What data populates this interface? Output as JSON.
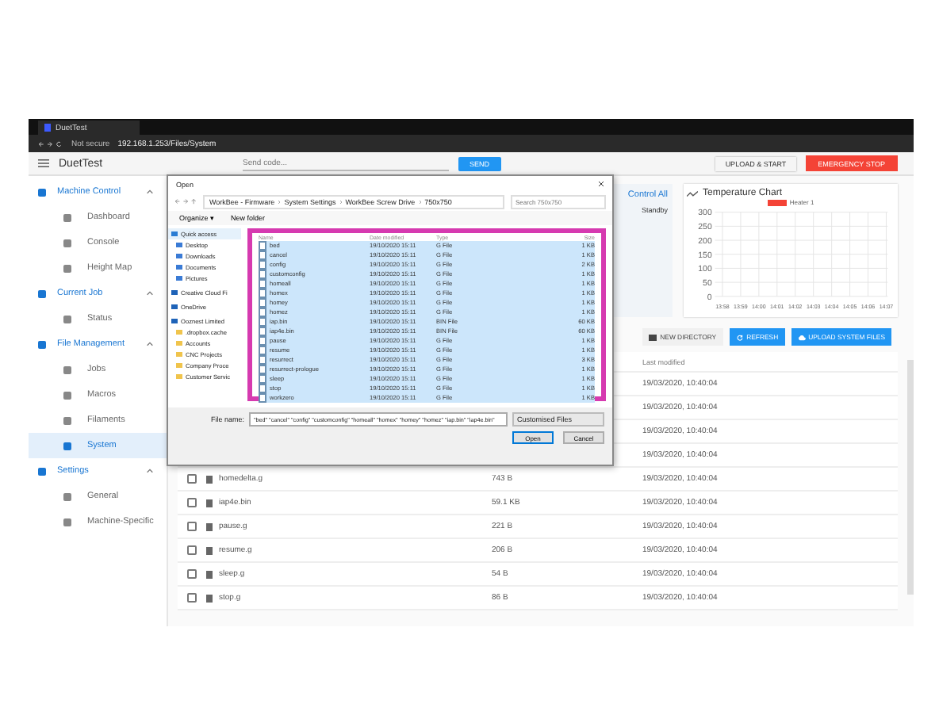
{
  "browser": {
    "tab": "DuetTest",
    "security": "Not secure",
    "address": "192.168.1.253/Files/System"
  },
  "app_bar": {
    "title": "DuetTest",
    "code_placeholder": "Send code...",
    "send": "SEND",
    "upload_start": "UPLOAD & START",
    "emergency": "EMERGENCY STOP"
  },
  "sidebar": [
    {
      "label": "Machine Control",
      "expanded": true,
      "children": [
        {
          "label": "Dashboard",
          "selected": false
        },
        {
          "label": "Console",
          "selected": false
        },
        {
          "label": "Height Map",
          "selected": false
        }
      ]
    },
    {
      "label": "Current Job",
      "expanded": true,
      "children": [
        {
          "label": "Status",
          "selected": false
        }
      ]
    },
    {
      "label": "File Management",
      "expanded": true,
      "children": [
        {
          "label": "Jobs",
          "selected": false
        },
        {
          "label": "Macros",
          "selected": false
        },
        {
          "label": "Filaments",
          "selected": false
        },
        {
          "label": "System",
          "selected": true
        }
      ]
    },
    {
      "label": "Settings",
      "expanded": true,
      "children": [
        {
          "label": "General",
          "selected": false
        },
        {
          "label": "Machine-Specific",
          "selected": false
        }
      ]
    }
  ],
  "tools_panel": {
    "control_all": "Control All",
    "standby": "Standby"
  },
  "temperature_chart": {
    "title": "Temperature Chart",
    "chart_data": {
      "type": "line",
      "grid": true,
      "categories": [
        "13:58",
        "13:59",
        "14:00",
        "14:01",
        "14:02",
        "14:03",
        "14:04",
        "14:05",
        "14:06",
        "14:07"
      ],
      "ylim": [
        0,
        300
      ],
      "yticks": [
        0,
        50,
        100,
        150,
        200,
        250,
        300
      ],
      "series": [
        {
          "name": "Heater 1",
          "color": "#f44336",
          "values": [
            null,
            null,
            null,
            null,
            null,
            null,
            null,
            null,
            null,
            null
          ]
        }
      ]
    }
  },
  "file_actions": {
    "new_directory": "NEW DIRECTORY",
    "refresh": "REFRESH",
    "upload": "UPLOAD SYSTEM FILES"
  },
  "file_table": {
    "last_modified_header": "Last modified",
    "rows": [
      {
        "modified": "19/03/2020, 10:40:04"
      },
      {
        "modified": "19/03/2020, 10:40:04"
      },
      {
        "modified": "19/03/2020, 10:40:04"
      },
      {
        "modified": "19/03/2020, 10:40:04"
      },
      {
        "name": "homedelta.g",
        "size": "743 B",
        "modified": "19/03/2020, 10:40:04",
        "checked": false
      },
      {
        "name": "iap4e.bin",
        "size": "59.1 KB",
        "modified": "19/03/2020, 10:40:04",
        "checked": false
      },
      {
        "name": "pause.g",
        "size": "221 B",
        "modified": "19/03/2020, 10:40:04",
        "checked": false
      },
      {
        "name": "resume.g",
        "size": "206 B",
        "modified": "19/03/2020, 10:40:04",
        "checked": false
      },
      {
        "name": "sleep.g",
        "size": "54 B",
        "modified": "19/03/2020, 10:40:04",
        "checked": false
      },
      {
        "name": "stop.g",
        "size": "86 B",
        "modified": "19/03/2020, 10:40:04",
        "checked": false
      }
    ]
  },
  "open_dialog": {
    "title": "Open",
    "path": [
      "WorkBee - Firmware",
      "System Settings",
      "WorkBee Screw Drive",
      "750x750"
    ],
    "search_placeholder": "Search 750x750",
    "organize": "Organize ▾",
    "new_folder": "New folder",
    "nav": [
      {
        "label": "Quick access",
        "kind": "star"
      },
      {
        "label": "Desktop",
        "kind": "pinned"
      },
      {
        "label": "Downloads",
        "kind": "pinned"
      },
      {
        "label": "Documents",
        "kind": "pinned"
      },
      {
        "label": "Pictures",
        "kind": "pinned"
      },
      {
        "label": "Creative Cloud Fi",
        "kind": "cloud"
      },
      {
        "label": "OneDrive",
        "kind": "cloud"
      },
      {
        "label": "Ooznest Limited",
        "kind": "cloud"
      },
      {
        "label": ".dropbox.cache",
        "kind": "folder"
      },
      {
        "label": "Accounts",
        "kind": "folder"
      },
      {
        "label": "CNC Projects",
        "kind": "folder"
      },
      {
        "label": "Company Proce",
        "kind": "folder"
      },
      {
        "label": "Customer Servic",
        "kind": "folder"
      }
    ],
    "columns": [
      "Name",
      "Date modified",
      "Type",
      "Size"
    ],
    "files": [
      {
        "name": "bed",
        "date": "19/10/2020 15:11",
        "type": "G File",
        "size": "1 KB",
        "selected": true
      },
      {
        "name": "cancel",
        "date": "19/10/2020 15:11",
        "type": "G File",
        "size": "1 KB",
        "selected": true
      },
      {
        "name": "config",
        "date": "19/10/2020 15:11",
        "type": "G File",
        "size": "2 KB",
        "selected": true
      },
      {
        "name": "customconfig",
        "date": "19/10/2020 15:11",
        "type": "G File",
        "size": "1 KB",
        "selected": true
      },
      {
        "name": "homeall",
        "date": "19/10/2020 15:11",
        "type": "G File",
        "size": "1 KB",
        "selected": true
      },
      {
        "name": "homex",
        "date": "19/10/2020 15:11",
        "type": "G File",
        "size": "1 KB",
        "selected": true
      },
      {
        "name": "homey",
        "date": "19/10/2020 15:11",
        "type": "G File",
        "size": "1 KB",
        "selected": true
      },
      {
        "name": "homez",
        "date": "19/10/2020 15:11",
        "type": "G File",
        "size": "1 KB",
        "selected": true
      },
      {
        "name": "iap.bin",
        "date": "19/10/2020 15:11",
        "type": "BIN File",
        "size": "60 KB",
        "selected": true
      },
      {
        "name": "iap4e.bin",
        "date": "19/10/2020 15:11",
        "type": "BIN File",
        "size": "60 KB",
        "selected": true
      },
      {
        "name": "pause",
        "date": "19/10/2020 15:11",
        "type": "G File",
        "size": "1 KB",
        "selected": true
      },
      {
        "name": "resume",
        "date": "19/10/2020 15:11",
        "type": "G File",
        "size": "1 KB",
        "selected": true
      },
      {
        "name": "resurrect",
        "date": "19/10/2020 15:11",
        "type": "G File",
        "size": "3 KB",
        "selected": true
      },
      {
        "name": "resurrect-prologue",
        "date": "19/10/2020 15:11",
        "type": "G File",
        "size": "1 KB",
        "selected": true
      },
      {
        "name": "sleep",
        "date": "19/10/2020 15:11",
        "type": "G File",
        "size": "1 KB",
        "selected": true
      },
      {
        "name": "stop",
        "date": "19/10/2020 15:11",
        "type": "G File",
        "size": "1 KB",
        "selected": true
      },
      {
        "name": "workzero",
        "date": "19/10/2020 15:11",
        "type": "G File",
        "size": "1 KB",
        "selected": true
      }
    ],
    "file_name_label": "File name:",
    "file_name_value": "\"bed\" \"cancel\" \"config\" \"customconfig\" \"homeall\" \"homex\" \"homey\" \"homez\" \"iap.bin\" \"iap4e.bin\"",
    "filter": "Customised Files",
    "open": "Open",
    "cancel": "Cancel"
  }
}
